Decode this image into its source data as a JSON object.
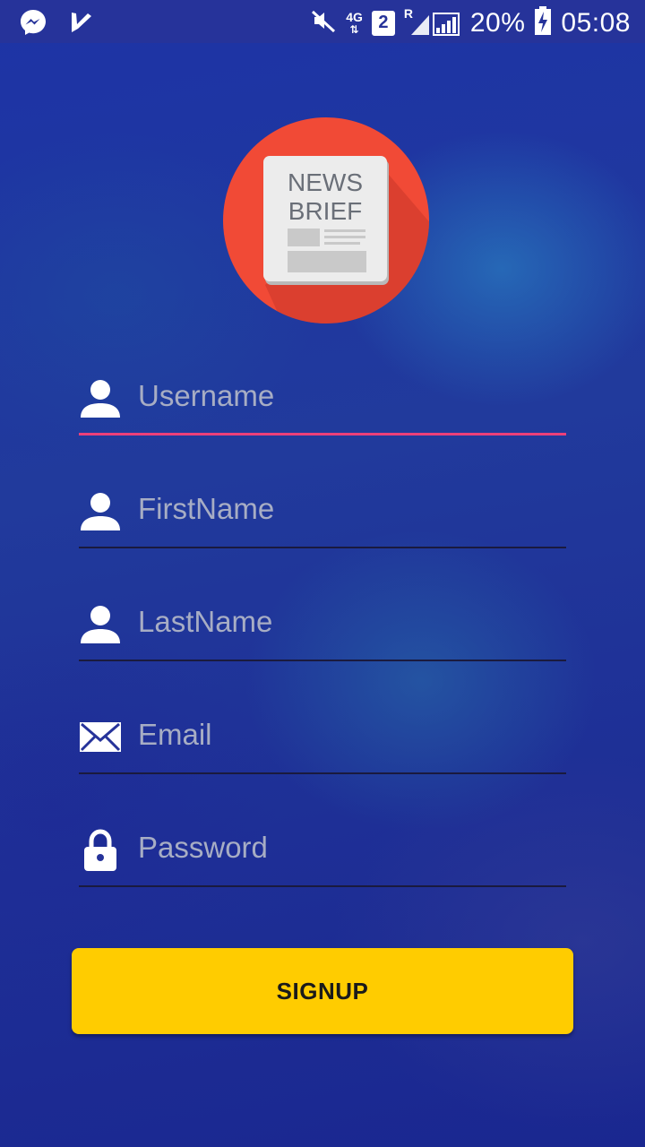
{
  "status_bar": {
    "network": "4G",
    "sim": "2",
    "roaming": "R",
    "battery": "20%",
    "time": "05:08",
    "icons": [
      "messenger-icon",
      "check-icon",
      "mute-icon",
      "signal-icon",
      "battery-icon"
    ]
  },
  "logo": {
    "line1": "NEWS",
    "line2": "BRIEF"
  },
  "form": {
    "username_placeholder": "Username",
    "firstname_placeholder": "FirstName",
    "lastname_placeholder": "LastName",
    "email_placeholder": "Email",
    "password_placeholder": "Password"
  },
  "signup_label": "SIGNUP",
  "colors": {
    "accent_line": "#ec407a",
    "button": "#ffcc00",
    "logo_circle": "#f14a36"
  }
}
